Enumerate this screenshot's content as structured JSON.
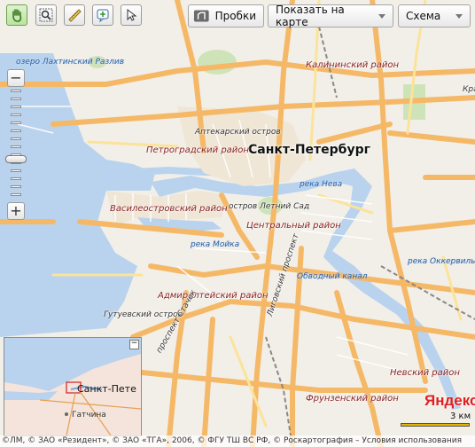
{
  "toolbar": {
    "tools": [
      "hand-icon",
      "magnifier-icon",
      "ruler-icon",
      "add-point-icon",
      "select-arrow-icon"
    ],
    "traffic_label": "Пробки",
    "show_on_map_label": "Показать на карте",
    "map_type_label": "Схема"
  },
  "zoom": {
    "plus": "+",
    "minus": "−",
    "level": 0.32
  },
  "map": {
    "city_label": "Санкт-Петербург",
    "districts": [
      "Калининский район",
      "Петроградский район",
      "Василеостровский район",
      "Центральный район",
      "Адмиралтейский район",
      "Невский район",
      "Фрунзенский район"
    ],
    "places": [
      "Аптекарский остров",
      "остров Летний Сад",
      "Гутуевский остров",
      "Кра"
    ],
    "water": [
      "озеро Лахтинский Разлив",
      "река Нева",
      "река Мойка",
      "Обводный канал",
      "река Оккервиль"
    ],
    "streets": [
      "проспект Стачек",
      "Лиговский проспект"
    ]
  },
  "minimap": {
    "label": "Санкт-Пете",
    "town": "Гатчина",
    "close": "−"
  },
  "brand": "Яндекс",
  "scale": "3 км",
  "copyright": "©ЛМ, © ЗАО «Резидент», © ЗАО «ТГА», 2006, © ФГУ ТШ ВС РФ, © Роскартография – Условия использования"
}
